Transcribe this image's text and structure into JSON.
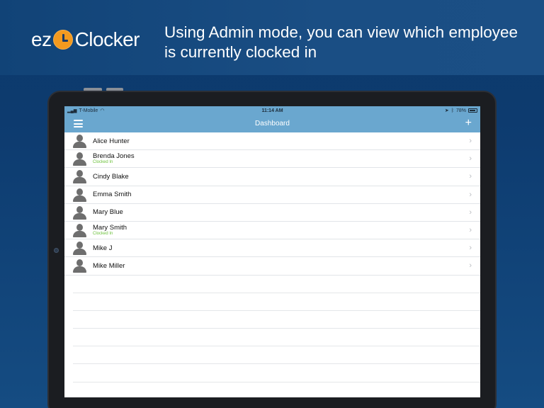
{
  "banner": {
    "logo_prefix": "ez",
    "logo_brand": "Clocker",
    "tagline": "Using Admin mode, you can view which employee is currently clocked in"
  },
  "statusbar": {
    "carrier": "T-Mobile",
    "time": "11:14 AM",
    "battery": "78%"
  },
  "navbar": {
    "title": "Dashboard",
    "menu_icon": "hamburger-icon",
    "add_icon": "plus-icon",
    "add_glyph": "+"
  },
  "employees": [
    {
      "name": "Alice Hunter",
      "status": ""
    },
    {
      "name": "Brenda Jones",
      "status": "Clocked In"
    },
    {
      "name": "Cindy Blake",
      "status": ""
    },
    {
      "name": "Emma Smith",
      "status": ""
    },
    {
      "name": "Mary Blue",
      "status": ""
    },
    {
      "name": "Mary Smith",
      "status": "Clocked In"
    },
    {
      "name": "Mike J",
      "status": ""
    },
    {
      "name": "Mike Miller",
      "status": ""
    }
  ],
  "colors": {
    "nav_bar": "#6aa7cf",
    "clocked_in": "#6bc13a",
    "logo_clock": "#f39a1f",
    "background": "#0d3b6f"
  }
}
